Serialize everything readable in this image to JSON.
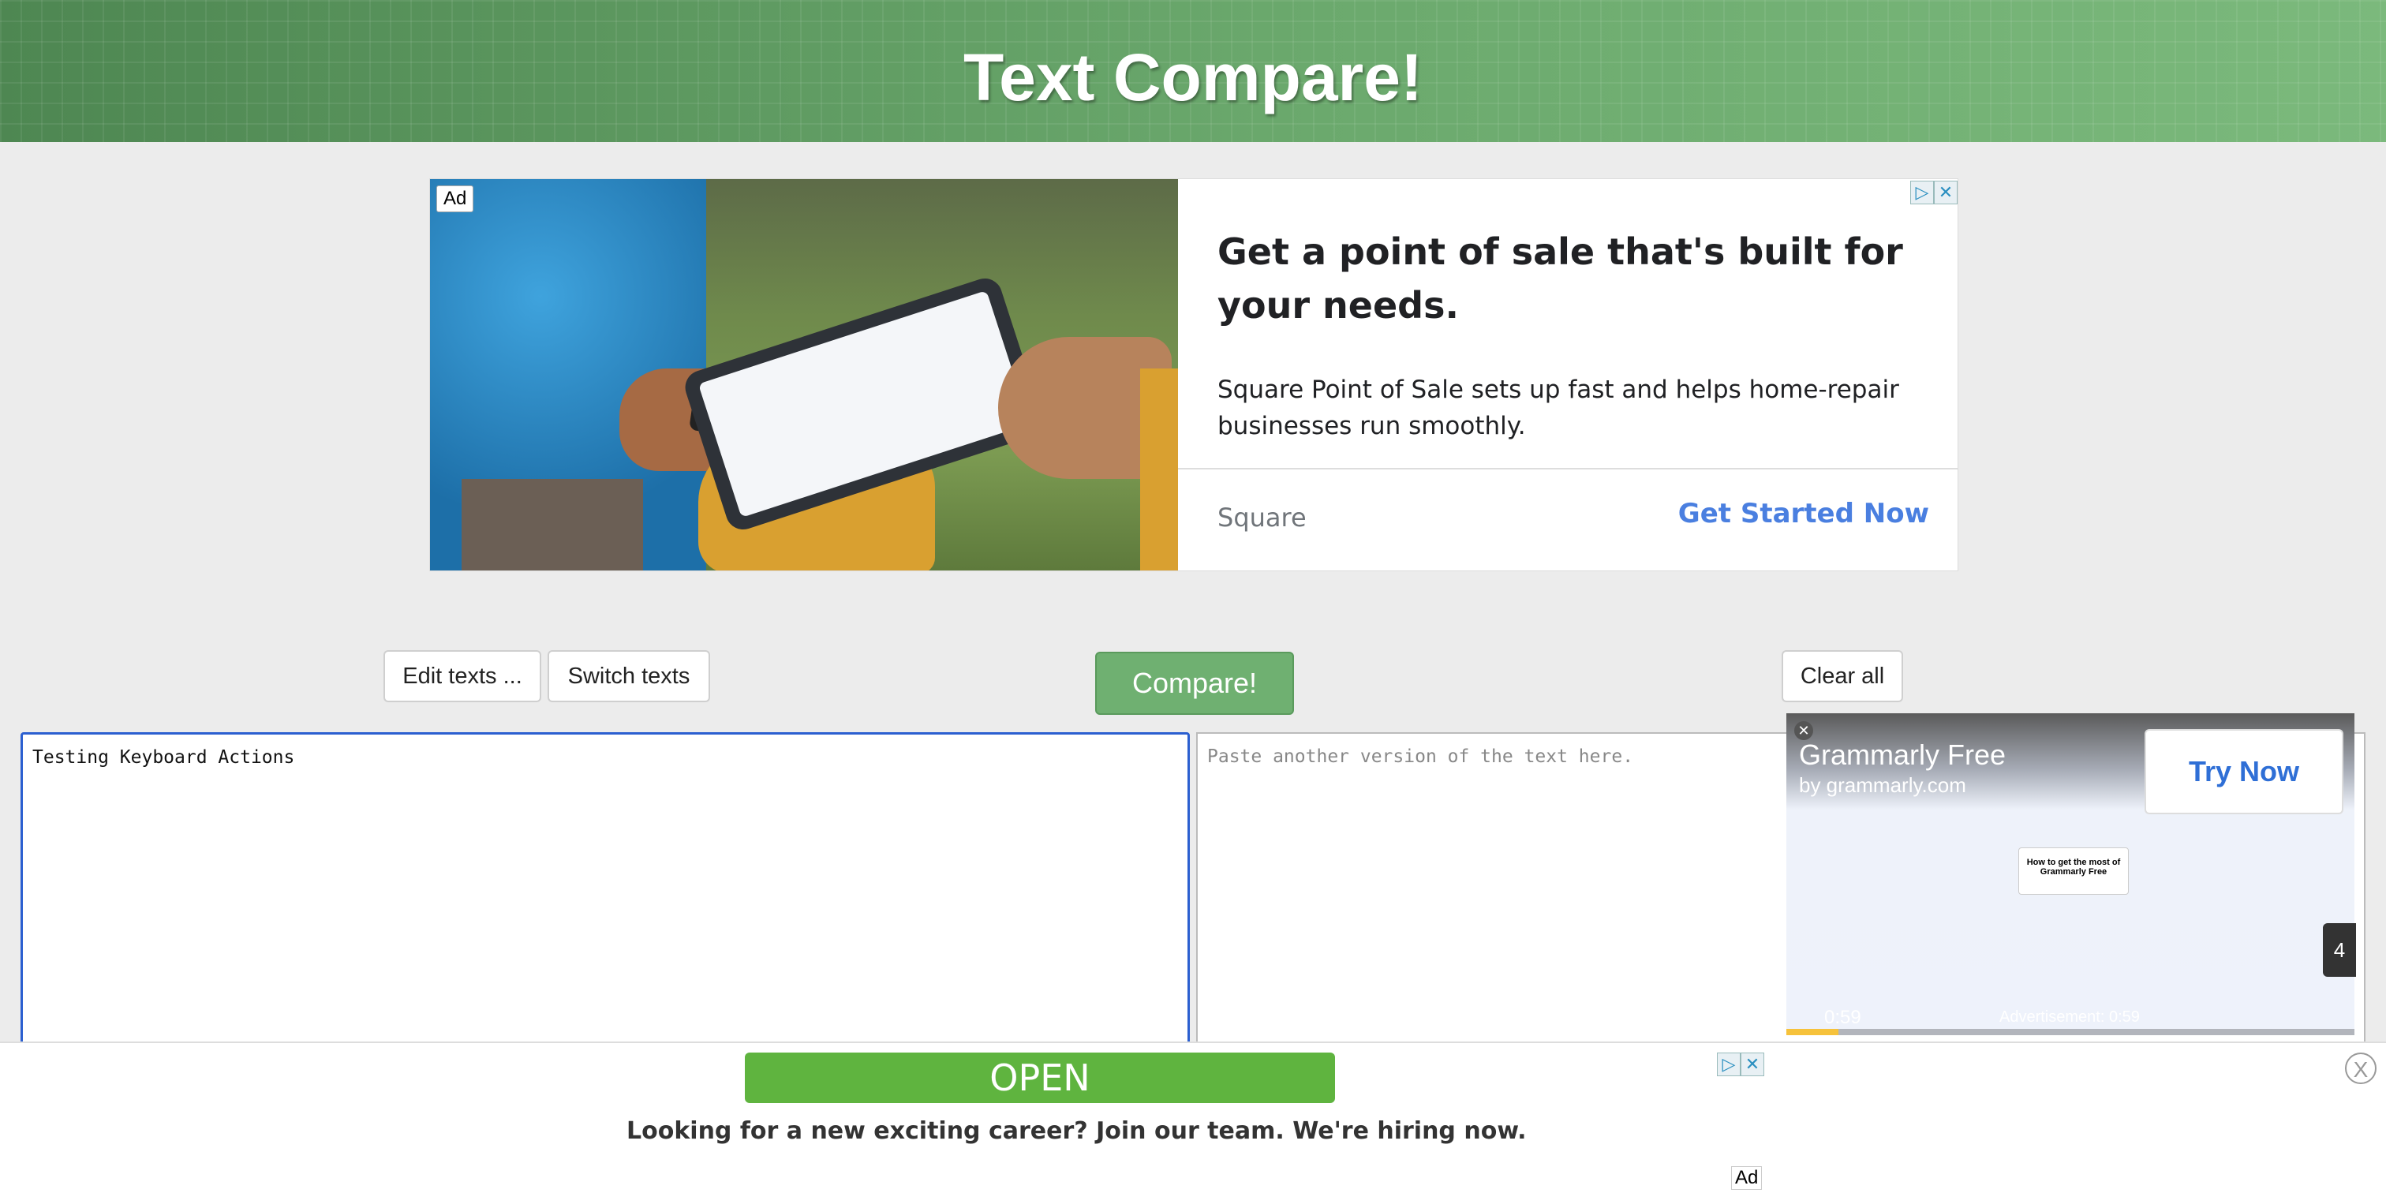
{
  "header": {
    "title": "Text Compare!"
  },
  "top_ad": {
    "ad_label": "Ad",
    "headline": "Get a point of sale that's built for your needs.",
    "body": "Square Point of Sale sets up fast and helps home-repair businesses run smoothly.",
    "advertiser": "Square",
    "cta": "Get Started Now",
    "adchoices_icon": "▷",
    "close_icon": "✕"
  },
  "toolbar": {
    "edit_label": "Edit texts ...",
    "switch_label": "Switch texts",
    "compare_label": "Compare!",
    "clear_label": "Clear all"
  },
  "editors": {
    "left_value": "Testing Keyboard Actions",
    "right_placeholder": "Paste another version of the text here."
  },
  "video_ad": {
    "title": "Grammarly Free",
    "subtitle": "by grammarly.com",
    "cta": "Try Now",
    "thumbnail_text": "How to get the most of Grammarly Free",
    "time": "0:59",
    "ad_time": "Advertisement: 0:59",
    "side_counter": "4",
    "close_icon": "✕"
  },
  "bottom_ad": {
    "open_label": "OPEN",
    "text": "Looking for a new exciting career? Join our team. We're hiring now.",
    "ad_tag": "Ad",
    "close_icon": "X",
    "adchoices_icon": "▷",
    "x_icon": "✕"
  },
  "colors": {
    "header_green": "#6aa56c",
    "compare_green": "#6fb071",
    "cta_blue": "#4a7fe0",
    "open_green": "#5fb43f",
    "focus_blue": "#2b5fd0"
  }
}
